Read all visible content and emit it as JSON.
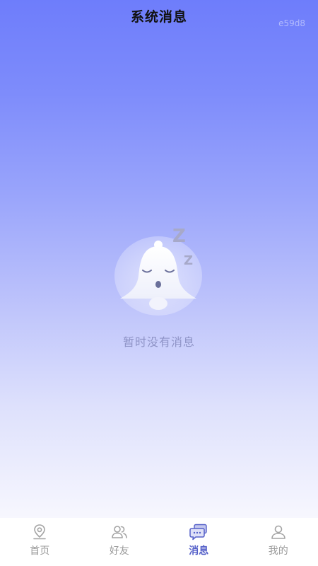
{
  "header": {
    "title": "系统消息",
    "watermark": "e59d8"
  },
  "empty_state": {
    "illustration": "sleeping-bell-icon",
    "message": "暂时没有消息"
  },
  "tabbar": {
    "tabs": [
      {
        "label": "首页",
        "icon": "home-pin-icon",
        "active": false
      },
      {
        "label": "好友",
        "icon": "friends-icon",
        "active": false
      },
      {
        "label": "消息",
        "icon": "message-icon",
        "active": true
      },
      {
        "label": "我的",
        "icon": "profile-icon",
        "active": false
      }
    ]
  },
  "colors": {
    "gradient_top": "#6e7dfb",
    "gradient_bottom": "#f7f7fe",
    "active_tab": "#5560c9",
    "inactive_tab": "#9a9a9a",
    "empty_text": "#8e93c6"
  }
}
